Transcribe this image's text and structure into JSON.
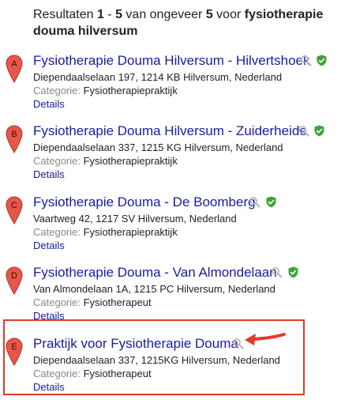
{
  "summary": {
    "prefix": "Resultaten ",
    "range_start": "1",
    "range_sep": " - ",
    "range_end": "5",
    "middle": " van ongeveer ",
    "count": "5",
    "for_text": " voor ",
    "query": "fysiotherapie douma hilversum"
  },
  "category_label": "Categorie:",
  "details_label": "Details",
  "colors": {
    "link": "#1a1aa6",
    "marker": "#e8564a",
    "verified": "#3fa33a",
    "highlight": "#e5392a"
  },
  "results": [
    {
      "letter": "A",
      "title": "Fysiotherapie Douma Hilversum - Hilvertshoek",
      "address": "Diependaalselaan 197, 1214 KB Hilversum, Nederland",
      "category": "Fysiotherapiepraktijk",
      "verified": true
    },
    {
      "letter": "B",
      "title": "Fysiotherapie Douma Hilversum - Zuiderheide",
      "address": "Diependaalselaan 337, 1215 KG Hilversum, Nederland",
      "category": "Fysiotherapiepraktijk",
      "verified": true
    },
    {
      "letter": "C",
      "title": "Fysiotherapie Douma - De Boomberg",
      "address": "Vaartweg 42, 1217 SV Hilversum, Nederland",
      "category": "Fysiotherapiepraktijk",
      "verified": true
    },
    {
      "letter": "D",
      "title": "Fysiotherapie Douma - Van Almondelaan",
      "address": "Van Almondelaan 1A, 1215 PC Hilversum, Nederland",
      "category": "Fysiotherapeut",
      "verified": true
    },
    {
      "letter": "E",
      "title": "Praktijk voor Fysiotherapie Douma",
      "address": "Diependaalselaan 337, 1215KG Hilversum, Nederland",
      "category": "Fysiotherapeut",
      "verified": false
    }
  ]
}
